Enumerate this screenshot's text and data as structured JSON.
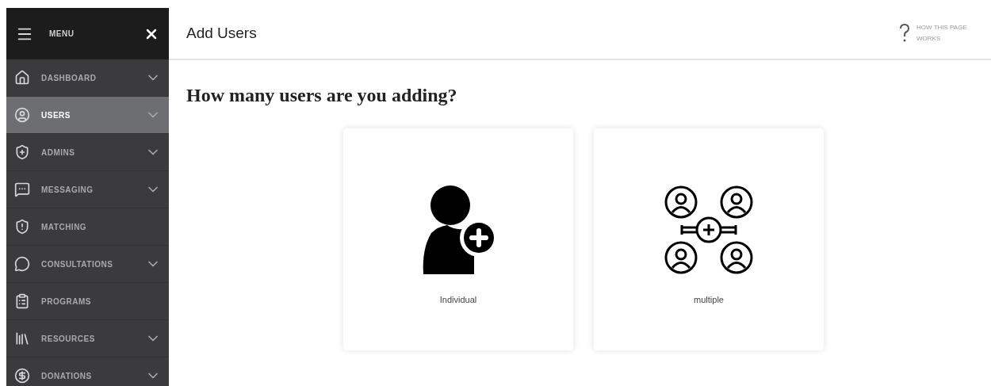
{
  "sidebar": {
    "title": "MENU",
    "items": [
      {
        "label": "DASHBOARD",
        "selected": false,
        "expandable": true
      },
      {
        "label": "USERS",
        "selected": true,
        "expandable": true
      },
      {
        "label": "ADMINS",
        "selected": false,
        "expandable": true
      },
      {
        "label": "MESSAGING",
        "selected": false,
        "expandable": true
      },
      {
        "label": "MATCHING",
        "selected": false,
        "expandable": false
      },
      {
        "label": "CONSULTATIONS",
        "selected": false,
        "expandable": true
      },
      {
        "label": "PROGRAMS",
        "selected": false,
        "expandable": false
      },
      {
        "label": "RESOURCES",
        "selected": false,
        "expandable": true
      },
      {
        "label": "DONATIONS",
        "selected": false,
        "expandable": true
      }
    ]
  },
  "header": {
    "title": "Add Users",
    "help": "HOW THIS PAGE WORKS"
  },
  "question": "How many users are you adding?",
  "options": [
    {
      "kind": "individual",
      "label": "Individual"
    },
    {
      "kind": "multiple",
      "label": "multiple"
    }
  ]
}
